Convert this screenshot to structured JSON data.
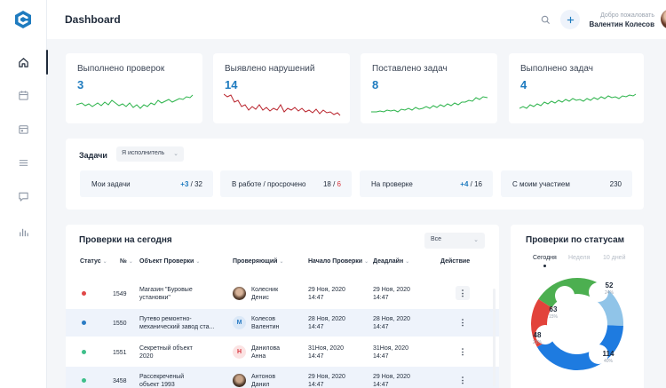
{
  "header": {
    "title": "Dashboard",
    "welcome": "Добро пожаловать",
    "user_name": "Валентин Колесов"
  },
  "sidebar": {
    "items": [
      {
        "icon": "home-icon",
        "active": true
      },
      {
        "icon": "calendar-icon",
        "active": false
      },
      {
        "icon": "calendar-check-icon",
        "active": false
      },
      {
        "icon": "menu-lines-icon",
        "active": false
      },
      {
        "icon": "chat-icon",
        "active": false
      },
      {
        "icon": "bar-chart-icon",
        "active": false
      }
    ]
  },
  "stats": [
    {
      "label": "Выполнено проверок",
      "value": "3",
      "color": "#2bb34a"
    },
    {
      "label": "Выявлено нарушений",
      "value": "14",
      "color": "#b9232c"
    },
    {
      "label": "Поставлено задач",
      "value": "8",
      "color": "#2bb34a"
    },
    {
      "label": "Выполнено задач",
      "value": "4",
      "color": "#2bb34a"
    }
  ],
  "tasks": {
    "title": "Задачи",
    "filter": "Я исполнитель",
    "tiles": [
      {
        "label": "Мои задачи",
        "a": "+3",
        "b": " / 32"
      },
      {
        "label": "В работе / просрочено",
        "a": "18",
        "b": " / ",
        "c": "6"
      },
      {
        "label": "На проверке",
        "a": "+4",
        "b": " / 16"
      },
      {
        "label": "С моим участием",
        "a": "230",
        "b": ""
      }
    ]
  },
  "checks": {
    "title": "Проверки на сегодня",
    "filter": "Все",
    "columns": {
      "status": "Статус",
      "num": "№",
      "object": "Объект Проверки",
      "reviewer": "Проверяющий",
      "start": "Начало Проверки",
      "deadline": "Деадлайн",
      "action": "Действие"
    },
    "rows": [
      {
        "dot": "#e04848",
        "num": "1549",
        "object1": "Магазин \"Буровые",
        "object2": "установки\"",
        "rev1": "Колесник",
        "rev2": "Денис",
        "start1": "29 Ноя, 2020",
        "start2": "14:47",
        "dl1": "29 Ноя, 2020",
        "dl2": "14:47",
        "avatar": "photo",
        "initial": ""
      },
      {
        "dot": "#2a7bc4",
        "num": "1550",
        "object1": "Путево ремонтно-",
        "object2": "механический завод ста...",
        "rev1": "Колесов",
        "rev2": "Валентин",
        "start1": "28 Ноя, 2020",
        "start2": "14:47",
        "dl1": "28 Ноя, 2020",
        "dl2": "14:47",
        "avatar": "letter",
        "initial": "М",
        "avatar_bg": "#dbe8f7",
        "avatar_fg": "#2a7bc4"
      },
      {
        "dot": "#3ebf8a",
        "num": "1551",
        "object1": "Секретный объект",
        "object2": "2020",
        "rev1": "Данилова",
        "rev2": "Анна",
        "start1": "31Ноя, 2020",
        "start2": "14:47",
        "dl1": "31Ноя, 2020",
        "dl2": "14:47",
        "avatar": "letter",
        "initial": "Н",
        "avatar_bg": "#fbe3e3",
        "avatar_fg": "#d9363e"
      },
      {
        "dot": "#3ebf8a",
        "num": "3458",
        "object1": "Рассекреченый",
        "object2": "объект 1993",
        "rev1": "Антонов",
        "rev2": "Данил",
        "start1": "29 Ноя, 2020",
        "start2": "14:47",
        "dl1": "29 Ноя, 2020",
        "dl2": "14:47",
        "avatar": "photo",
        "initial": ""
      }
    ],
    "action_glyph": "⋮"
  },
  "status_chart": {
    "title": "Проверки по статусам",
    "tabs": [
      "Сегодня",
      "Неделя",
      "10 дней"
    ],
    "segments": [
      {
        "value": 63,
        "pct": "15%",
        "color": "#4caf50"
      },
      {
        "value": 52,
        "pct": "24%",
        "color": "#90c4e8"
      },
      {
        "value": 114,
        "pct": "40%",
        "color": "#1e7be0"
      },
      {
        "value": 48,
        "pct": "21%",
        "color": "#e2433b"
      }
    ]
  }
}
